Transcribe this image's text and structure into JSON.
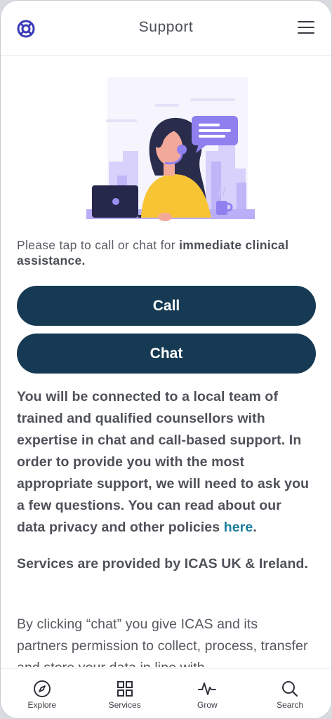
{
  "header": {
    "title": "Support",
    "logo_icon": "lifebuoy-icon",
    "menu_icon": "hamburger-menu-icon"
  },
  "main": {
    "intro_prefix": "Please tap to call or chat for ",
    "intro_bold": "immediate clinical assistance.",
    "call_label": "Call",
    "chat_label": "Chat",
    "para1": "You will be connected to a local team of trained and qualified counsellors with expertise in chat and call-based support. In order to provide you with the most appropriate support, we will need to ask you a few questions. You can read about our data privacy and other policies ",
    "para1_link": "here",
    "para1_end": ".",
    "para2": "Services are provided by ICAS UK & Ireland.",
    "para3": "By clicking “chat” you give ICAS and its partners permission to collect, process, transfer and store your data in line with"
  },
  "tabbar": {
    "items": [
      {
        "label": "Explore",
        "icon": "compass-icon"
      },
      {
        "label": "Services",
        "icon": "grid-icon"
      },
      {
        "label": "Grow",
        "icon": "pulse-icon"
      },
      {
        "label": "Search",
        "icon": "search-icon"
      }
    ]
  },
  "colors": {
    "primary_button": "#163a53",
    "accent": "#3b3ab8",
    "link": "#1a7c9c",
    "illustration_purple": "#8f80f0",
    "illustration_yellow": "#f7c534"
  }
}
